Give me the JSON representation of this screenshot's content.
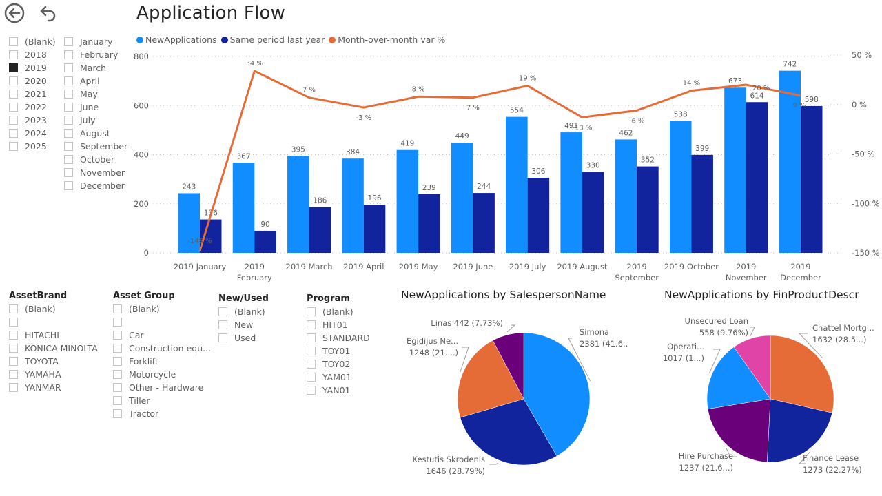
{
  "nav": {
    "back_icon": "circle-arrow-left-icon",
    "undo_icon": "undo-arrow-icon"
  },
  "title": "Application Flow",
  "colors": {
    "new": "#118DFF",
    "last": "#12239E",
    "var": "#E66C37",
    "purple": "#6B007B",
    "magenta": "#E044A7"
  },
  "year_slicer": {
    "items": [
      {
        "label": "(Blank)",
        "checked": false
      },
      {
        "label": "2018",
        "checked": false
      },
      {
        "label": "2019",
        "checked": true
      },
      {
        "label": "2020",
        "checked": false
      },
      {
        "label": "2021",
        "checked": false
      },
      {
        "label": "2022",
        "checked": false
      },
      {
        "label": "2023",
        "checked": false
      },
      {
        "label": "2024",
        "checked": false
      },
      {
        "label": "2025",
        "checked": false
      }
    ]
  },
  "month_slicer": {
    "items": [
      {
        "label": "January",
        "checked": false
      },
      {
        "label": "February",
        "checked": false
      },
      {
        "label": "March",
        "checked": false
      },
      {
        "label": "April",
        "checked": false
      },
      {
        "label": "May",
        "checked": false
      },
      {
        "label": "June",
        "checked": false
      },
      {
        "label": "July",
        "checked": false
      },
      {
        "label": "August",
        "checked": false
      },
      {
        "label": "September",
        "checked": false
      },
      {
        "label": "October",
        "checked": false
      },
      {
        "label": "November",
        "checked": false
      },
      {
        "label": "December",
        "checked": false
      }
    ]
  },
  "asset_brand": {
    "header": "AssetBrand",
    "items": [
      "(Blank)",
      "",
      "HITACHI",
      "KONICA MINOLTA",
      "TOYOTA",
      "YAMAHA",
      "YANMAR"
    ]
  },
  "asset_group": {
    "header": "Asset Group",
    "items": [
      "(Blank)",
      "",
      "Car",
      "Construction equ...",
      "Forklift",
      "Motorcycle",
      "Other - Hardware",
      "Tiller",
      "Tractor"
    ]
  },
  "new_used": {
    "header": "New/Used",
    "items": [
      "(Blank)",
      "New",
      "Used"
    ]
  },
  "program": {
    "header": "Program",
    "items": [
      "(Blank)",
      "HIT01",
      "STANDARD",
      "TOY01",
      "TOY02",
      "YAM01",
      "YAN01"
    ]
  },
  "chart_data": [
    {
      "type": "bar",
      "title": "Application Flow",
      "legend": [
        "NewApplications",
        "Same period last year",
        "Month-over-month var %"
      ],
      "legend_position": "top-left",
      "categories": [
        [
          "2019 January"
        ],
        [
          "2019",
          "February"
        ],
        [
          "2019 March"
        ],
        [
          "2019 April"
        ],
        [
          "2019 May"
        ],
        [
          "2019 June"
        ],
        [
          "2019 July"
        ],
        [
          "2019 August"
        ],
        [
          "2019",
          "September"
        ],
        [
          "2019 October"
        ],
        [
          "2019",
          "November"
        ],
        [
          "2019",
          "December"
        ]
      ],
      "series": [
        {
          "name": "NewApplications",
          "type": "bar",
          "values": [
            243,
            367,
            395,
            384,
            419,
            449,
            554,
            491,
            462,
            538,
            673,
            742
          ]
        },
        {
          "name": "Same period last year",
          "type": "bar",
          "values": [
            136,
            90,
            186,
            196,
            239,
            244,
            306,
            330,
            352,
            399,
            614,
            598
          ]
        },
        {
          "name": "Month-over-month var %",
          "type": "line",
          "axis": "right",
          "values": [
            -148,
            34,
            7,
            -3,
            8,
            7,
            19,
            -13,
            -6,
            14,
            20,
            9
          ],
          "labels": [
            "-148 %",
            "34 %",
            "7 %",
            "-3 %",
            "8 %",
            "7 %",
            "19 %",
            "-13 %",
            "-6 %",
            "14 %",
            "20 %",
            "9 %"
          ]
        }
      ],
      "y_left": {
        "ticks": [
          0,
          200,
          400,
          600,
          800
        ],
        "ylim": [
          0,
          800
        ]
      },
      "y_right": {
        "ticks": [
          "50 %",
          "0 %",
          "-50 %",
          "-100 %",
          "-150 %"
        ],
        "values": [
          50,
          0,
          -50,
          -100,
          -150
        ],
        "ylim": [
          -150,
          50
        ]
      },
      "grid": true
    },
    {
      "type": "pie",
      "title": "NewApplications by SalespersonName",
      "slices": [
        {
          "name": "Simona",
          "value": 2381,
          "label1": "Simona",
          "label2": "2381 (41.6...)",
          "color": "#118DFF"
        },
        {
          "name": "Kestutis Skrodenis",
          "value": 1646,
          "label1": "Kestutis Skrodenis",
          "label2": "1646 (28.79%)",
          "color": "#12239E"
        },
        {
          "name": "Egidijus Ne...",
          "value": 1248,
          "label1": "Egidijus Ne...",
          "label2": "1248 (21....)",
          "color": "#E66C37"
        },
        {
          "name": "Linas",
          "value": 442,
          "label1": "Linas 442 (7.73%)",
          "label2": "",
          "color": "#6B007B"
        }
      ]
    },
    {
      "type": "pie",
      "title": "NewApplications by FinProductDescr",
      "slices": [
        {
          "name": "Chattel Mortg...",
          "value": 1632,
          "label1": "Chattel Mortg...",
          "label2": "1632 (28.5...)",
          "color": "#E66C37"
        },
        {
          "name": "Finance Lease",
          "value": 1273,
          "label1": "Finance Lease",
          "label2": "1273 (22.27%)",
          "color": "#12239E"
        },
        {
          "name": "Hire Purchase",
          "value": 1237,
          "label1": "Hire Purchase",
          "label2": "1237 (21.6...)",
          "color": "#6B007B"
        },
        {
          "name": "Operati...",
          "value": 1017,
          "label1": "Operati...",
          "label2": "1017 (1...)",
          "color": "#118DFF"
        },
        {
          "name": "Unsecured Loan",
          "value": 558,
          "label1": "Unsecured Loan",
          "label2": "558 (9.76%)",
          "color": "#E044A7"
        }
      ]
    }
  ]
}
